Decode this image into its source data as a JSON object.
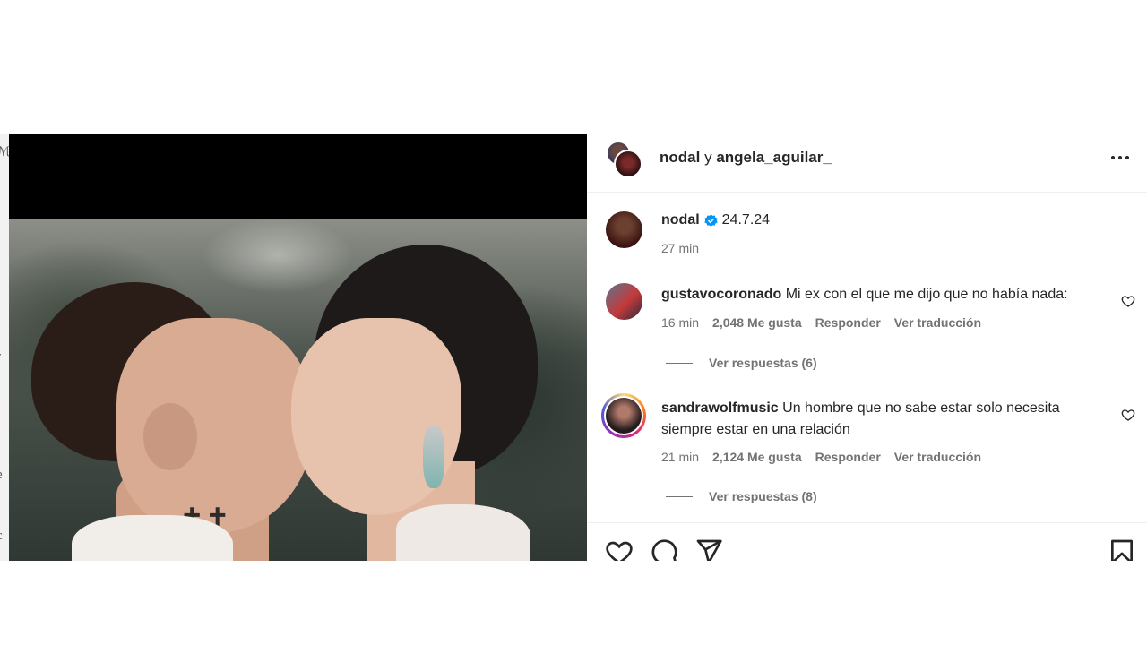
{
  "header": {
    "user1": "nodal",
    "joiner": "y",
    "user2": "angela_aguilar_",
    "more_icon": "more-horizontal-icon"
  },
  "caption": {
    "username": "nodal",
    "verified_icon": "verified-badge-icon",
    "text": "24.7.24",
    "time": "27 min"
  },
  "comments": [
    {
      "username": "gustavocoronado",
      "text": "Mi ex con el que me dijo que no había nada:",
      "time": "16 min",
      "likes": "2,048 Me gusta",
      "reply": "Responder",
      "translate": "Ver traducción",
      "view_replies": "Ver respuestas (6)"
    },
    {
      "username": "sandrawolfmusic",
      "text": "Un hombre que no sabe estar solo necesita siempre estar en una relación",
      "time": "21 min",
      "likes": "2,124 Me gusta",
      "reply": "Responder",
      "translate": "Ver traducción",
      "view_replies": "Ver respuestas (8)"
    }
  ],
  "actions": {
    "like": "heart-icon",
    "comment": "comment-icon",
    "share": "send-icon",
    "save": "bookmark-icon"
  },
  "colors": {
    "text": "#262626",
    "muted": "#737373",
    "verified": "#0095f6"
  }
}
